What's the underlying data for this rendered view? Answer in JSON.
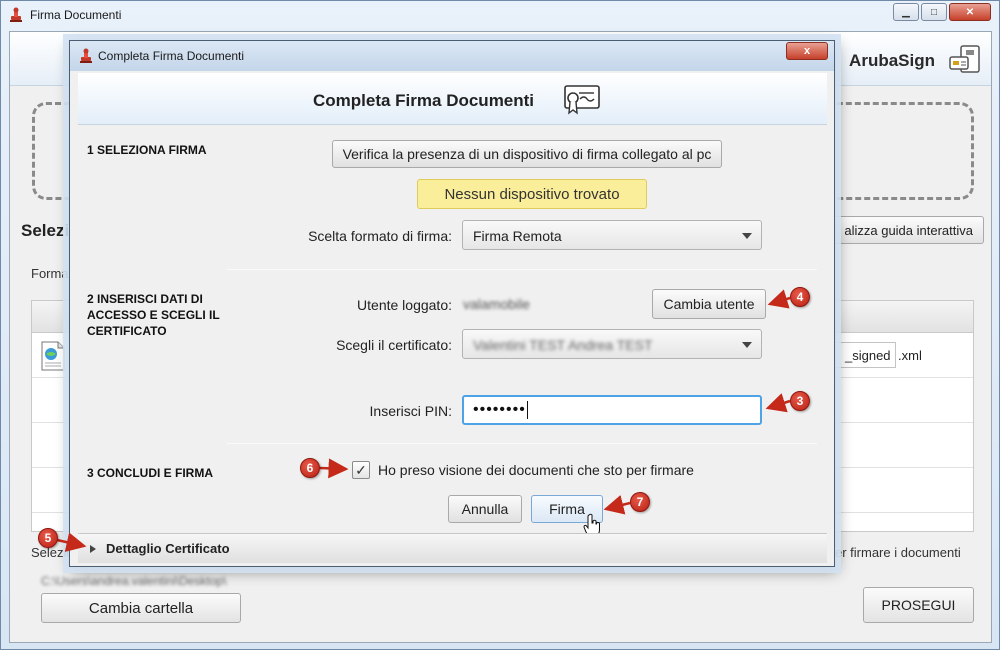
{
  "main_window": {
    "title": "Firma Documenti",
    "brand": "ArubaSign",
    "section_title": "Selezi",
    "guide_button_label": "alizza guida interattiva",
    "format_label": "Forma",
    "file_rows": [
      {
        "suffix": "_signed",
        "extension": ".xml"
      }
    ],
    "select_label": "Selezio",
    "hint_text": "er firmare i documenti",
    "folder_path": "C:\\Users\\andrea.valentini\\Desktop\\",
    "change_folder_label": "Cambia cartella",
    "proceed_label": "PROSEGUI"
  },
  "dialog": {
    "title": "Completa Firma Documenti",
    "banner_title": "Completa Firma Documenti",
    "close_label": "x",
    "step1": {
      "label": "1 SELEZIONA FIRMA",
      "verify_button": "Verifica la presenza di un dispositivo di firma collegato al pc",
      "status_badge": "Nessun dispositivo trovato",
      "format_label": "Scelta formato di firma:",
      "format_value": "Firma Remota"
    },
    "step2": {
      "label": "2 INSERISCI DATI DI ACCESSO E SCEGLI IL CERTIFICATO",
      "user_label": "Utente loggato:",
      "user_value": "valamobile",
      "change_user_button": "Cambia utente",
      "cert_label": "Scegli il certificato:",
      "cert_value": "Valentini TEST Andrea TEST",
      "pin_label": "Inserisci PIN:",
      "pin_value": "••••••••"
    },
    "step3": {
      "label": "3 CONCLUDI E FIRMA",
      "checkbox_checked": true,
      "checkbox_glyph": "✓",
      "checkbox_label": "Ho preso visione dei documenti che sto per firmare",
      "cancel_button": "Annulla",
      "sign_button": "Firma"
    },
    "details_label": "Dettaglio Certificato"
  },
  "markers": [
    "3",
    "4",
    "5",
    "6",
    "7"
  ],
  "colors": {
    "marker_red": "#c4291a",
    "badge_yellow": "#fbee9a",
    "focus_blue": "#4ea3e6"
  },
  "icons": [
    "app-stamp-icon",
    "arubasign-card-icon",
    "certificate-icon",
    "xml-file-icon",
    "hand-cursor-icon",
    "expand-arrow-icon",
    "dropdown-caret-icon"
  ]
}
